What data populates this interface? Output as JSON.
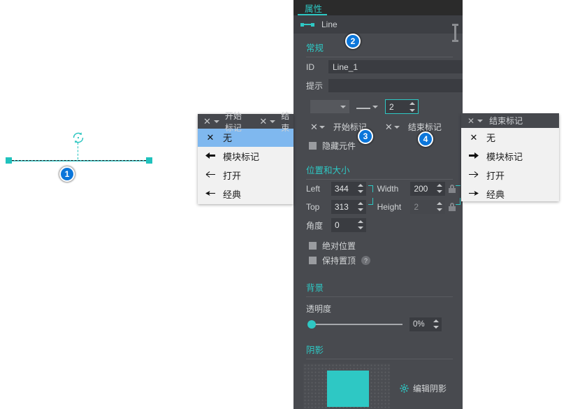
{
  "panel": {
    "tab_label": "属性",
    "object_name": "Line",
    "sections": {
      "general": "常规",
      "position_size": "位置和大小",
      "background": "背景",
      "shadow": "阴影"
    },
    "general": {
      "id_label": "ID",
      "id_value": "Line_1",
      "tip_label": "提示",
      "tip_value": "",
      "stroke_width": "2",
      "start_marker_label": "开始标记",
      "end_marker_label": "结束标记",
      "hide_widget_label": "隐藏元件",
      "hide_widget_checked": false
    },
    "position": {
      "left_label": "Left",
      "left_value": "344",
      "top_label": "Top",
      "top_value": "313",
      "width_label": "Width",
      "width_value": "200",
      "height_label": "Height",
      "height_value": "2",
      "angle_label": "角度",
      "angle_value": "0",
      "absolute_label": "绝对位置",
      "absolute_checked": false,
      "keep_top_label": "保持置顶",
      "keep_top_checked": false,
      "help_glyph": "?"
    },
    "background": {
      "opacity_label": "透明度",
      "opacity_value": "0%"
    },
    "shadow": {
      "edit_label": "编辑阴影",
      "swatch_color": "#2ec8c4"
    }
  },
  "dropdown_start": {
    "header_label": "开始标记",
    "items": [
      {
        "icon": "none-x-icon",
        "glyph": "✕",
        "label": "无",
        "selected": true
      },
      {
        "icon": "block-arrow-left-icon",
        "glyph": "⬅",
        "label": "模块标记",
        "selected": false
      },
      {
        "icon": "open-arrow-left-icon",
        "glyph": "←",
        "label": "打开",
        "selected": false
      },
      {
        "icon": "classic-arrow-left-icon",
        "glyph": "←",
        "label": "经典",
        "selected": false
      }
    ]
  },
  "dropdown_end": {
    "header_label": "结束标记",
    "items": [
      {
        "icon": "none-x-icon",
        "glyph": "✕",
        "label": "无",
        "selected": false
      },
      {
        "icon": "block-arrow-right-icon",
        "glyph": "➤",
        "label": "模块标记",
        "selected": false
      },
      {
        "icon": "open-arrow-right-icon",
        "glyph": "→",
        "label": "打开",
        "selected": false
      },
      {
        "icon": "classic-arrow-right-icon",
        "glyph": "→",
        "label": "经典",
        "selected": false
      }
    ]
  },
  "overlay_strip": {
    "start_label": "开始标记",
    "end_label": "结束"
  },
  "callouts": [
    {
      "id": 1,
      "text": "1"
    },
    {
      "id": 2,
      "text": "2"
    },
    {
      "id": 3,
      "text": "3"
    },
    {
      "id": 4,
      "text": "4"
    }
  ],
  "colors": {
    "accent": "#2ec8c4",
    "panel_bg": "#484a4f",
    "tabbar_bg": "#2b2b2b",
    "badge_blue": "#0b76da",
    "dropdown_selected": "#7fb8ef"
  }
}
